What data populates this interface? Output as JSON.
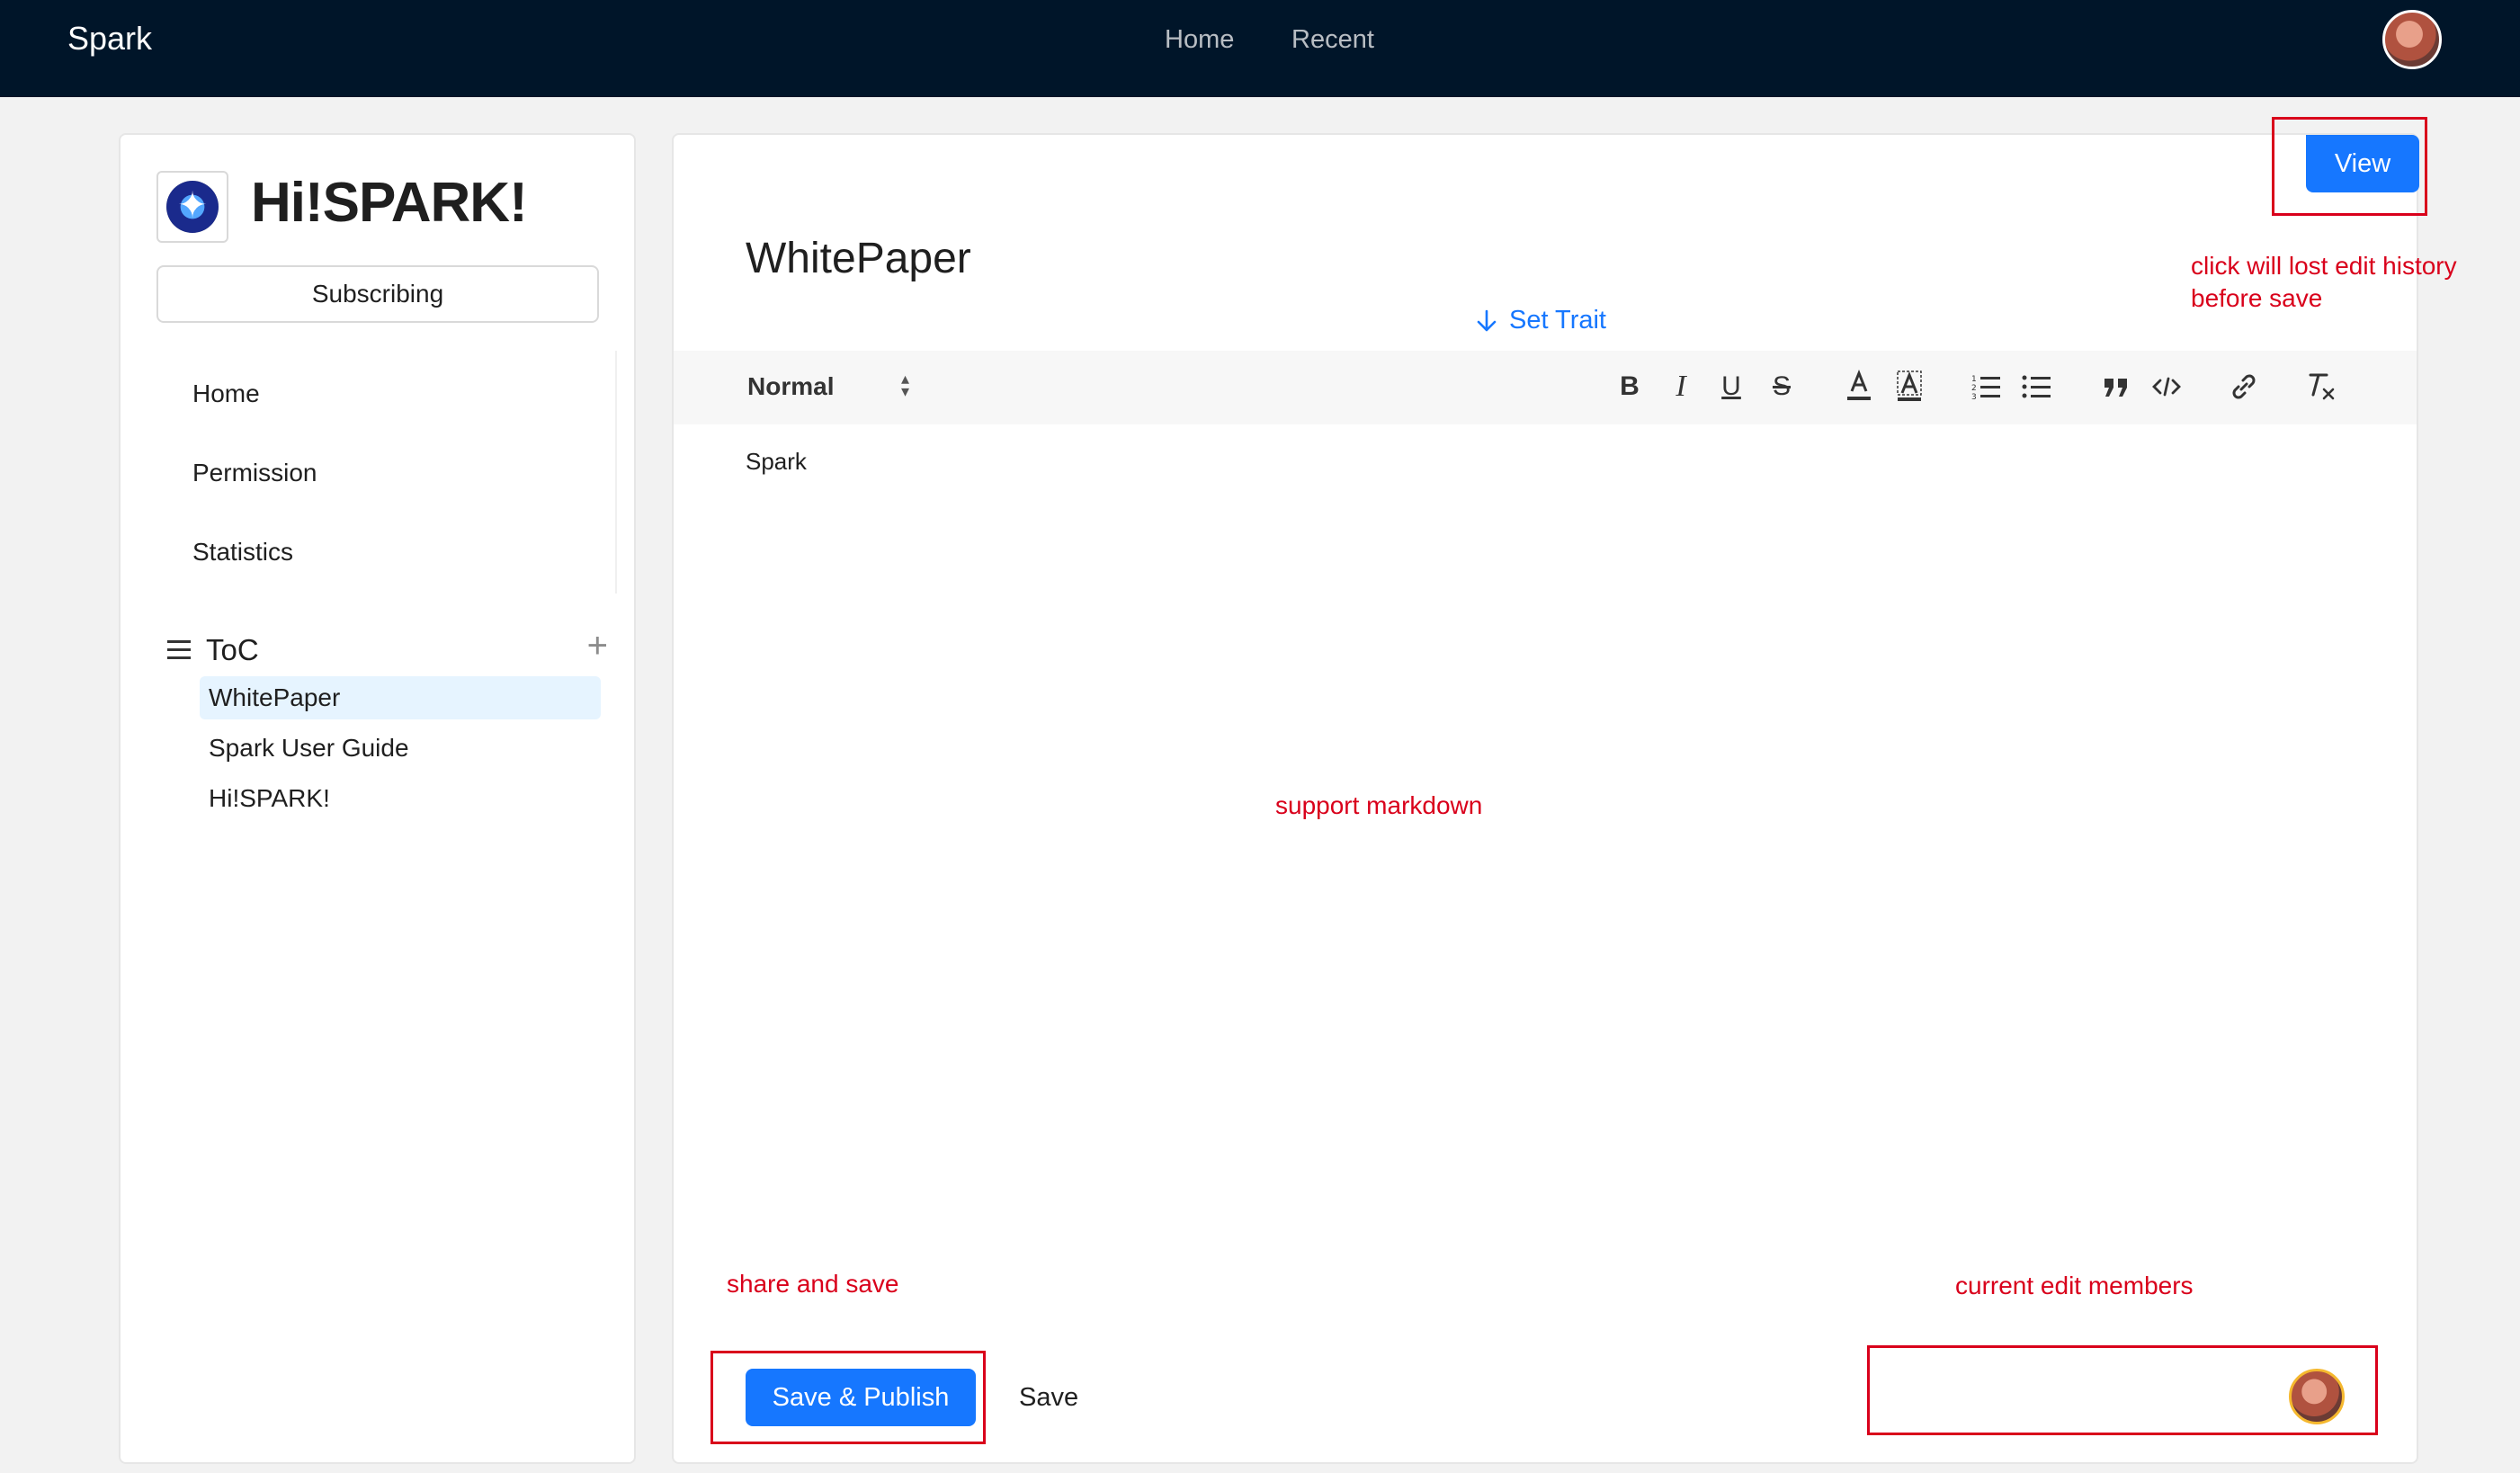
{
  "topnav": {
    "brand": "Spark",
    "items": [
      {
        "label": "Home"
      },
      {
        "label": "Recent"
      }
    ]
  },
  "sidebar": {
    "site_title": "Hi!SPARK!",
    "subscribe_label": "Subscribing",
    "menu": [
      {
        "label": "Home"
      },
      {
        "label": "Permission"
      },
      {
        "label": "Statistics"
      }
    ],
    "toc": {
      "label": "ToC",
      "add_icon": "plus-icon",
      "items": [
        {
          "label": "WhitePaper",
          "active": true
        },
        {
          "label": "Spark User Guide",
          "active": false
        },
        {
          "label": "Hi!SPARK!",
          "active": false
        }
      ]
    }
  },
  "editor": {
    "view_label": "View",
    "doc_title": "WhitePaper",
    "set_trait_label": "Set Trait",
    "toolbar": {
      "format_value": "Normal",
      "bold": "B",
      "italic": "I",
      "underline": "U",
      "strike": "S",
      "color": "A"
    },
    "content": "Spark",
    "save_publish_label": "Save & Publish",
    "save_label": "Save"
  },
  "annotations": {
    "view_note_line1": "click will lost edit history",
    "view_note_line2": "before save",
    "markdown_note": "support markdown",
    "share_note": "share and save",
    "members_note": "current edit members"
  },
  "colors": {
    "primary": "#1677ff",
    "nav_bg": "#001529",
    "annotation": "#d9001b"
  }
}
